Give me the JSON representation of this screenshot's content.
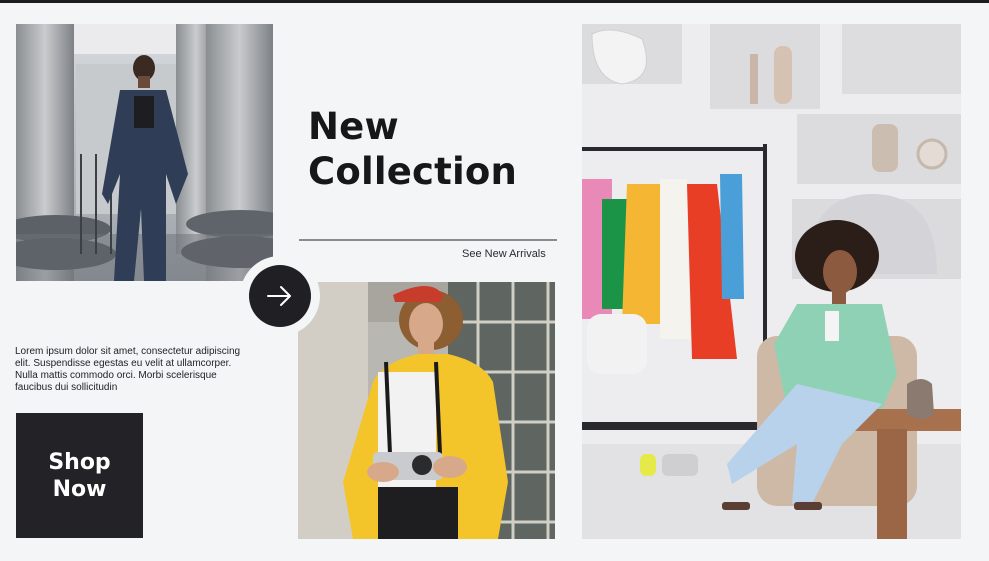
{
  "hero": {
    "title_line1": "New",
    "title_line2": "Collection",
    "see_link": "See New Arrivals"
  },
  "intro": {
    "text": "Lorem ipsum dolor sit amet, consectetur adipiscing elit. Suspendisse egestas eu velit at ullamcorper. Nulla mattis commodo orci. Morbi scelerisque faucibus dui sollicitudin"
  },
  "shop_button": {
    "line1": "Shop",
    "line2": "Now"
  },
  "icons": {
    "arrow": "arrow-right-icon"
  },
  "colors": {
    "background": "#f4f5f7",
    "dark": "#232327",
    "coat_yellow": "#f3c52a",
    "jacket_mint": "#8fd1b5"
  }
}
